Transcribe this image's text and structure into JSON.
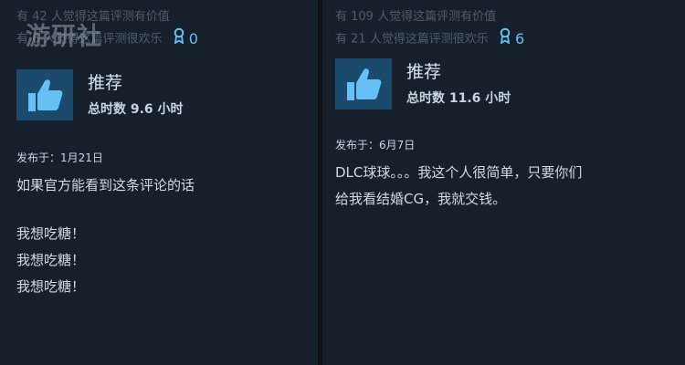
{
  "reviews": [
    {
      "helpful_line": "有 42 人觉得这篇评测有价值",
      "funny_line": "有 6 人觉得这篇评测很欢乐",
      "award_count": "0",
      "recommendation": "推荐",
      "playtime": "总时数 9.6 小时",
      "posted": "发布于：1月21日",
      "body_lines": [
        "如果官方能看到这条评论的话",
        "",
        "我想吃糖！",
        "我想吃糖！",
        "我想吃糖！"
      ]
    },
    {
      "helpful_line": "有 109 人觉得这篇评测有价值",
      "funny_line": "有 21 人觉得这篇评测很欢乐",
      "award_count": "6",
      "recommendation": "推荐",
      "playtime": "总时数 11.6 小时",
      "posted": "发布于：6月7日",
      "body_lines": [
        "DLC球球。。。我这个人很简单，只要你们",
        "给我看结婚CG，我就交钱。"
      ]
    }
  ],
  "watermark": "游研社",
  "icons": {
    "thumb": "thumbs-up-icon",
    "award": "award-ribbon-icon"
  },
  "colors": {
    "background": "#15202b",
    "accent": "#66c0f4",
    "thumb_bg": "#1a4a6c"
  }
}
